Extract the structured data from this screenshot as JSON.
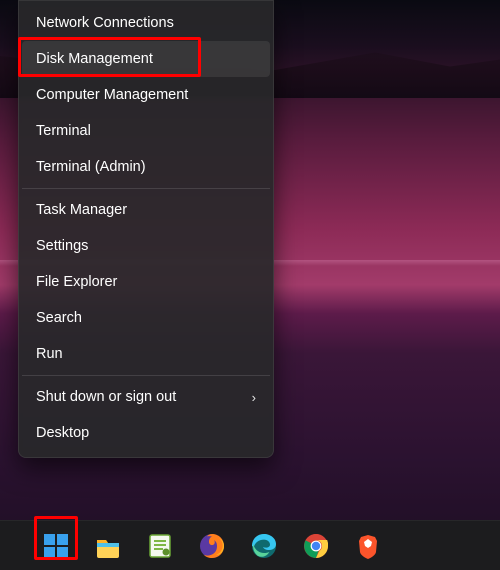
{
  "menu": {
    "groups": [
      [
        {
          "label": "Network Connections",
          "name": "menu-network-connections",
          "submenu": false
        },
        {
          "label": "Disk Management",
          "name": "menu-disk-management",
          "submenu": false,
          "hover": true,
          "annot": "hl-disk"
        },
        {
          "label": "Computer Management",
          "name": "menu-computer-management",
          "submenu": false
        },
        {
          "label": "Terminal",
          "name": "menu-terminal",
          "submenu": false
        },
        {
          "label": "Terminal (Admin)",
          "name": "menu-terminal-admin",
          "submenu": false
        }
      ],
      [
        {
          "label": "Task Manager",
          "name": "menu-task-manager",
          "submenu": false
        },
        {
          "label": "Settings",
          "name": "menu-settings",
          "submenu": false
        },
        {
          "label": "File Explorer",
          "name": "menu-file-explorer",
          "submenu": false
        },
        {
          "label": "Search",
          "name": "menu-search",
          "submenu": false
        },
        {
          "label": "Run",
          "name": "menu-run",
          "submenu": false
        }
      ],
      [
        {
          "label": "Shut down or sign out",
          "name": "menu-shutdown-signout",
          "submenu": true
        },
        {
          "label": "Desktop",
          "name": "menu-desktop",
          "submenu": false
        }
      ]
    ]
  },
  "taskbar": {
    "items": [
      {
        "name": "start-button",
        "icon": "windows-icon",
        "annot": "hl-start"
      },
      {
        "name": "file-explorer-button",
        "icon": "file-explorer-icon"
      },
      {
        "name": "notepadpp-button",
        "icon": "notepadpp-icon"
      },
      {
        "name": "firefox-button",
        "icon": "firefox-icon"
      },
      {
        "name": "edge-button",
        "icon": "edge-icon"
      },
      {
        "name": "chrome-button",
        "icon": "chrome-icon"
      },
      {
        "name": "brave-button",
        "icon": "brave-icon"
      }
    ]
  },
  "colors": {
    "highlight": "#ff0000",
    "menu_bg": "rgba(40,40,42,0.92)",
    "text": "#ffffff"
  }
}
